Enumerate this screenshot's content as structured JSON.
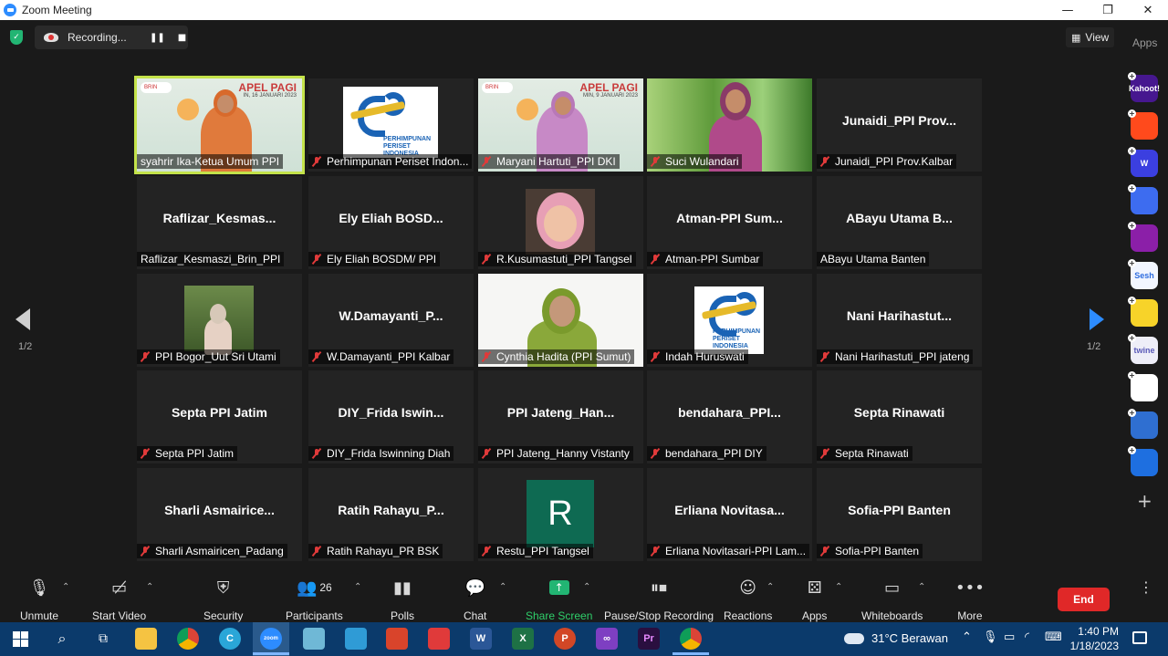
{
  "window": {
    "title": "Zoom Meeting",
    "controls": [
      "—",
      "❐",
      "✕"
    ]
  },
  "topbar": {
    "recording_label": "Recording...",
    "pause_symbol": "❚❚",
    "stop_symbol": "■",
    "view_label": "View",
    "apps_label": "Apps"
  },
  "tiles": [
    {
      "name": "syahrir Ika-Ketua Umum PPI",
      "kind": "apel",
      "muted": false,
      "active": true,
      "apel": "APEL PAGI",
      "apel_sub": "IN, 16 JANUARI 2023"
    },
    {
      "name": "Perhimpunan Periset Indon...",
      "kind": "logo",
      "muted": true
    },
    {
      "name": "Maryani Hartuti_PPI DKI",
      "kind": "apel2",
      "muted": true,
      "apel": "APEL PAGI",
      "apel_sub": "MIN, 9 JANUARI 2023"
    },
    {
      "name": "Suci Wulandari",
      "kind": "grass",
      "muted": true
    },
    {
      "name": "Junaidi_PPI Prov.Kalbar",
      "kind": "text",
      "big": "Junaidi_PPI  Prov...",
      "muted": true
    },
    {
      "name": "Raflizar_Kesmaszi_Brin_PPI",
      "kind": "text",
      "big": "Raflizar_Kesmas...",
      "muted": false
    },
    {
      "name": "Ely Eliah BOSDM/ PPI",
      "kind": "text",
      "big": "Ely  Eliah  BOSD...",
      "muted": true
    },
    {
      "name": "R.Kusumastuti_PPI Tangsel",
      "kind": "baby",
      "muted": true
    },
    {
      "name": "Atman-PPI Sumbar",
      "kind": "text",
      "big": "Atman-PPI  Sum...",
      "muted": true
    },
    {
      "name": "ABayu Utama Banten",
      "kind": "text",
      "big": "ABayu  Utama  B...",
      "muted": false
    },
    {
      "name": "PPI Bogor_Uut Sri Utami",
      "kind": "outdoor",
      "muted": true
    },
    {
      "name": "W.Damayanti_PPI Kalbar",
      "kind": "text",
      "big": "W.Damayanti_P...",
      "muted": true
    },
    {
      "name": "Cynthia Hadita (PPI Sumut)",
      "kind": "cynthia",
      "muted": true
    },
    {
      "name": "Indah Huruswati",
      "kind": "logo2",
      "muted": true
    },
    {
      "name": "Nani Harihastuti_PPI jateng",
      "kind": "text",
      "big": "Nani  Harihastut...",
      "muted": true
    },
    {
      "name": "Septa PPI Jatim",
      "kind": "text",
      "big": "Septa PPI Jatim",
      "muted": true
    },
    {
      "name": "DIY_Frida Iswinning Diah",
      "kind": "text",
      "big": "DIY_Frida  Iswin...",
      "muted": true
    },
    {
      "name": "PPI Jateng_Hanny Vistanty",
      "kind": "text",
      "big": "PPI  Jateng_Han...",
      "muted": true
    },
    {
      "name": "bendahara_PPI DIY",
      "kind": "text",
      "big": "bendahara_PPI...",
      "muted": true
    },
    {
      "name": "Septa Rinawati",
      "kind": "text",
      "big": "Septa Rinawati",
      "muted": true
    },
    {
      "name": "Sharli Asmairicen_Padang",
      "kind": "text",
      "big": "Sharli  Asmairice...",
      "muted": true
    },
    {
      "name": "Ratih Rahayu_PR BSK",
      "kind": "text",
      "big": "Ratih  Rahayu_P...",
      "muted": true
    },
    {
      "name": "Restu_PPI Tangsel",
      "kind": "avatar",
      "letter": "R",
      "muted": true
    },
    {
      "name": "Erliana Novitasari-PPI Lam...",
      "kind": "text",
      "big": "Erliana  Novitasa...",
      "muted": true
    },
    {
      "name": "Sofia-PPI Banten",
      "kind": "text",
      "big": "Sofia-PPI Banten",
      "muted": true
    }
  ],
  "logo_text": "PERHIMPUNAN\nPERISET\nINDONESIA",
  "brin_label": "BRIN",
  "pagination": {
    "left": "1/2",
    "right": "1/2"
  },
  "apps": [
    {
      "name": "Kahoot!",
      "label": "Kahoot!",
      "color": "#46178f"
    },
    {
      "name": "app-2",
      "label": "",
      "color": "#ff4a1c"
    },
    {
      "name": "W",
      "label": "W",
      "color": "#3b3fe0"
    },
    {
      "name": "app-4",
      "label": "",
      "color": "#3d6cf0"
    },
    {
      "name": "app-5",
      "label": "",
      "color": "#8b1fa8"
    },
    {
      "name": "Sesh",
      "label": "Sesh",
      "color": "#f2f6ff"
    },
    {
      "name": "app-7",
      "label": "",
      "color": "#f7d329"
    },
    {
      "name": "twine",
      "label": "twine",
      "color": "#eeeef8"
    },
    {
      "name": "app-9",
      "label": "",
      "color": "#ffffff"
    },
    {
      "name": "app-10",
      "label": "",
      "color": "#2f6fd1"
    },
    {
      "name": "app-11",
      "label": "",
      "color": "#1e6fe0"
    }
  ],
  "toolbar": {
    "unmute": "Unmute",
    "start_video": "Start Video",
    "security": "Security",
    "participants": "Participants",
    "participant_count": "26",
    "polls": "Polls",
    "chat": "Chat",
    "share_screen": "Share Screen",
    "pause_stop_recording": "Pause/Stop Recording",
    "reactions": "Reactions",
    "apps": "Apps",
    "whiteboards": "Whiteboards",
    "more": "More",
    "end": "End"
  },
  "taskbar": {
    "weather": "31°C  Berawan",
    "time": "1:40 PM",
    "date": "1/18/2023"
  }
}
